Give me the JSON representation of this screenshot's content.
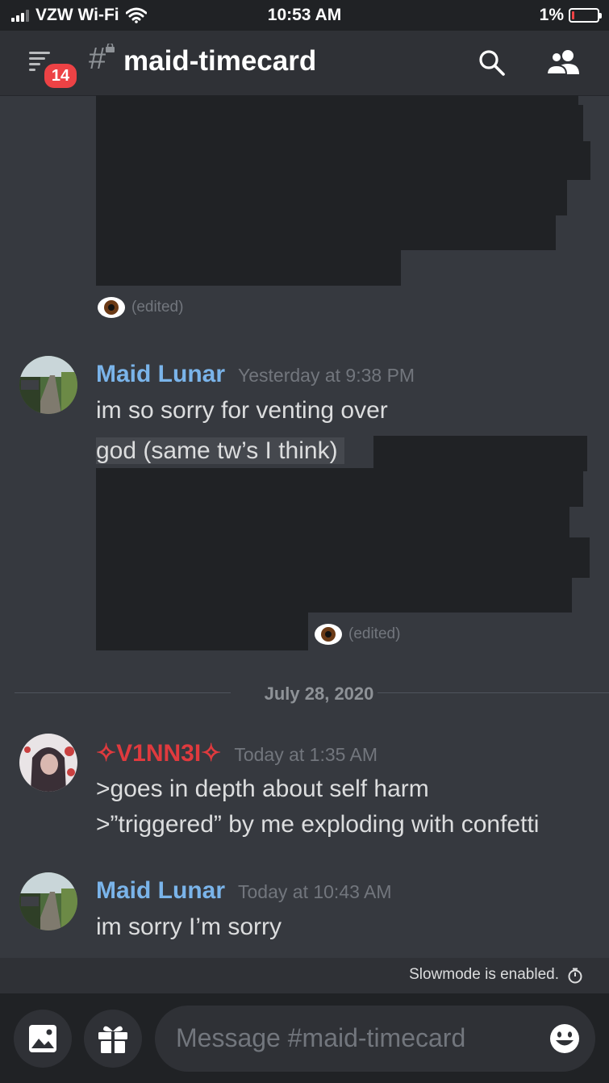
{
  "status_bar": {
    "carrier": "VZW Wi-Fi",
    "time": "10:53 AM",
    "battery": "1%"
  },
  "header": {
    "badge_count": "14",
    "channel": "maid-timecard"
  },
  "messages": [
    {
      "edited": "(edited)"
    },
    {
      "author": "Maid Lunar",
      "author_color": "#7ab4ea",
      "time": "Yesterday at 9:38 PM",
      "lines": [
        "im so sorry for venting over",
        "god (same tw’s I think)"
      ],
      "edited": "(edited)"
    },
    {
      "author": "✧V1NN3I✧",
      "author_color": "#e03a3e",
      "time": "Today at 1:35 AM",
      "lines": [
        ">goes in depth about self harm",
        ">”triggered” by me exploding with confetti"
      ]
    },
    {
      "author": "Maid Lunar",
      "author_color": "#7ab4ea",
      "time": "Today at 10:43 AM",
      "lines": [
        "im sorry I’m sorry"
      ]
    }
  ],
  "date_divider": "July 28, 2020",
  "slowmode": "Slowmode is enabled.",
  "composer": {
    "placeholder": "Message #maid-timecard"
  },
  "icons": [
    "menu-icon",
    "hash-icon",
    "lock-icon",
    "search-icon",
    "members-icon",
    "eye-emoji-icon",
    "image-icon",
    "gift-icon",
    "smiley-icon",
    "timer-icon"
  ]
}
